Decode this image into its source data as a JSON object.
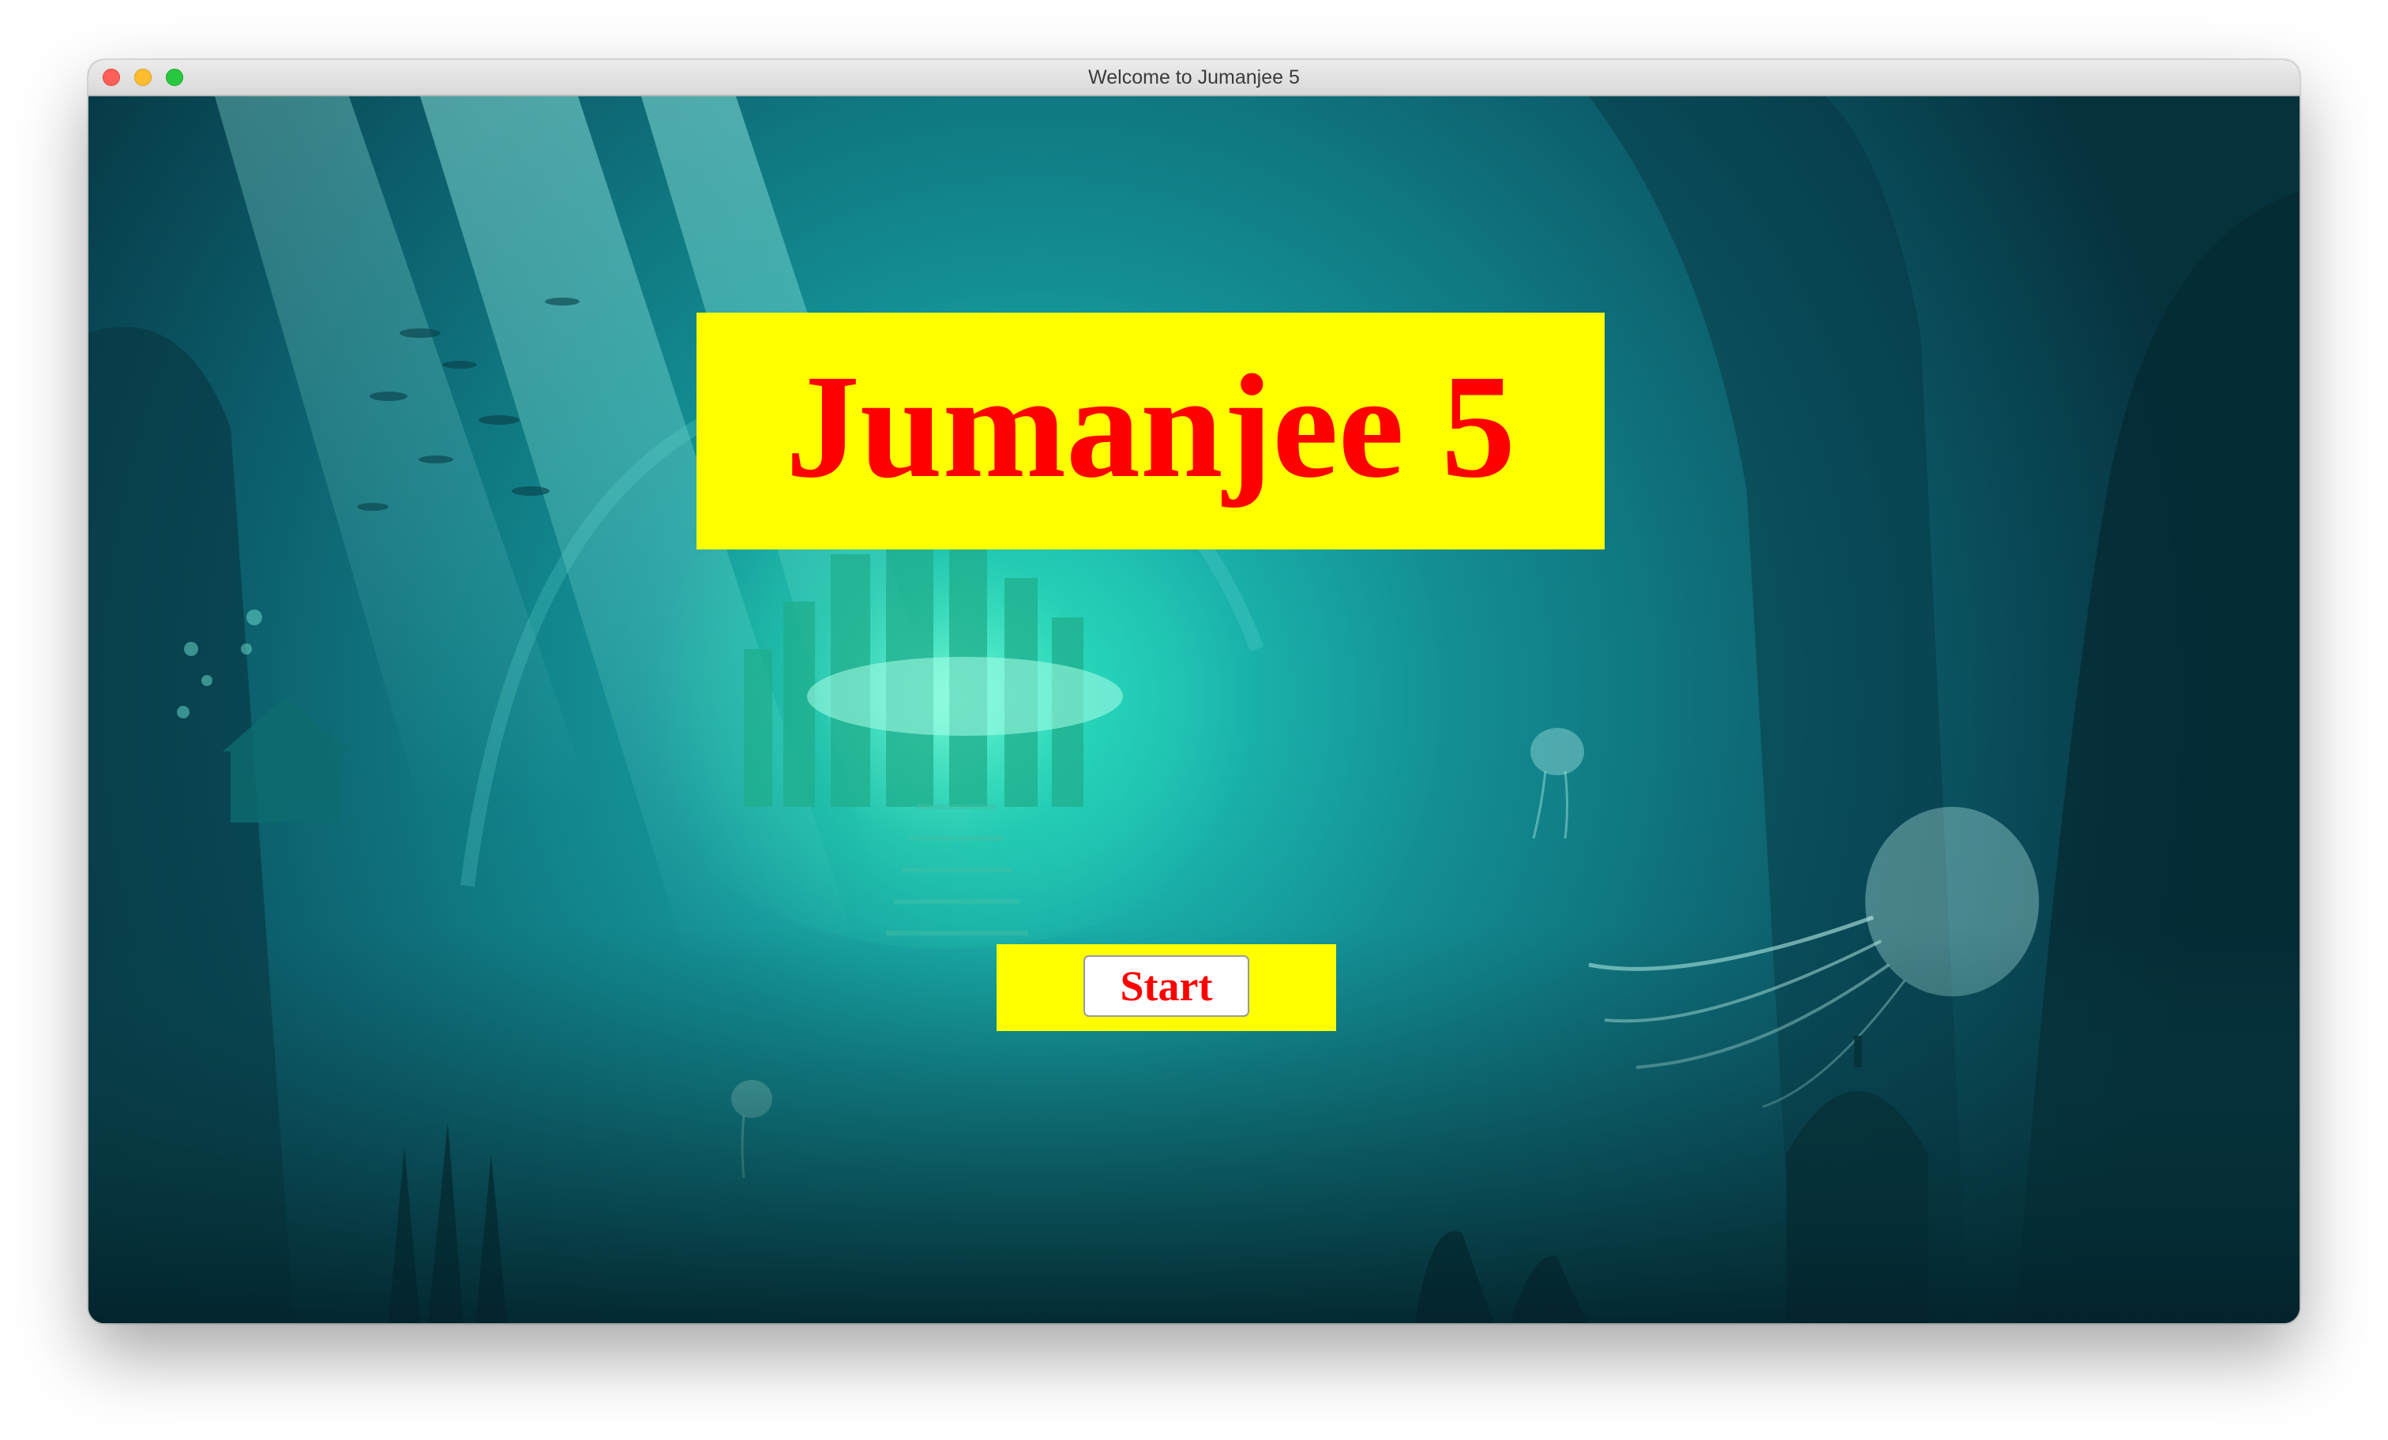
{
  "window": {
    "title": "Welcome to Jumanjee 5",
    "controls": {
      "close_icon": "close-icon",
      "minimize_icon": "minimize-icon",
      "maximize_icon": "maximize-icon"
    }
  },
  "game": {
    "title": "Jumanjee 5",
    "start_label": "Start",
    "background": "underwater-city-scene"
  },
  "colors": {
    "banner": "#ffff00",
    "title_text": "#ff0000",
    "water_dark": "#0b3a44",
    "water_light": "#1fd3c4"
  }
}
